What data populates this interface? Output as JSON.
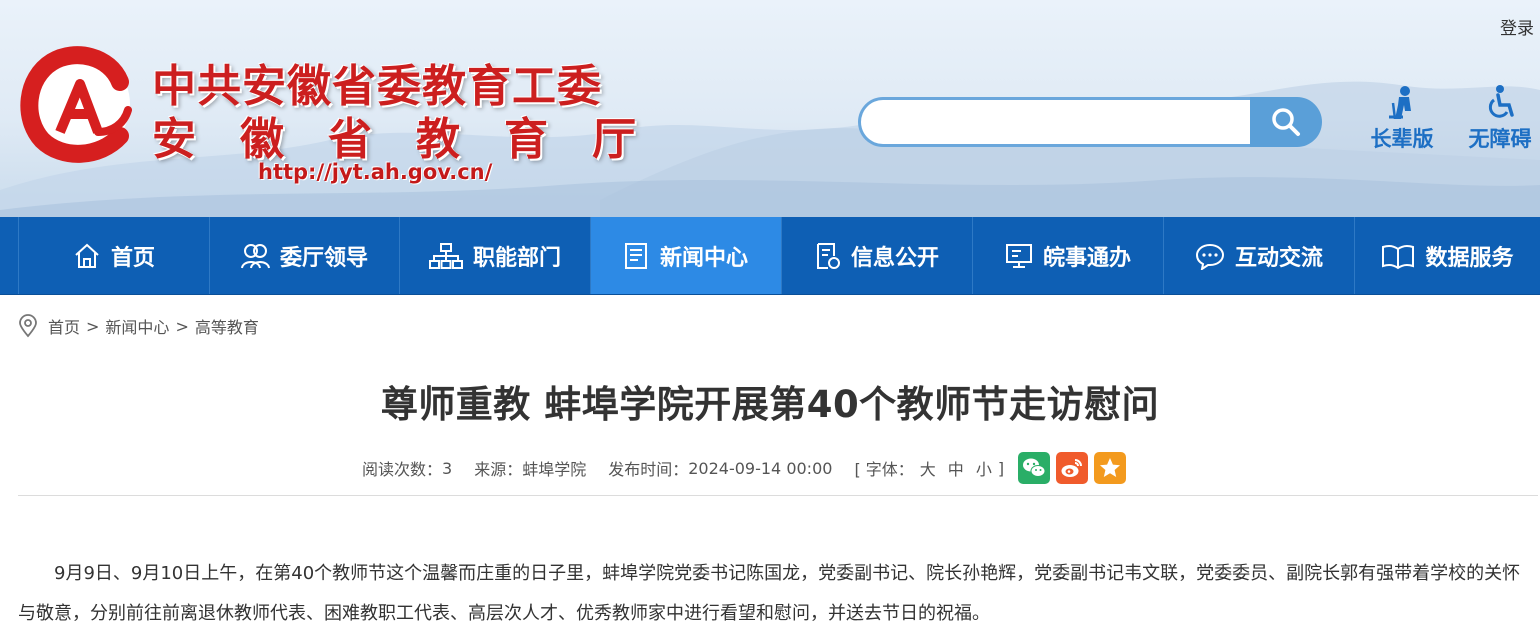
{
  "header": {
    "login_label": "登录",
    "org_name_line1": "中共安徽省委教育工委",
    "org_name_line2": "安徽省教育厅",
    "site_url": "http://jyt.ah.gov.cn/",
    "search_placeholder": "",
    "search_icon": "search-icon",
    "utilities": [
      {
        "label": "长辈版",
        "icon": "elder-person-icon"
      },
      {
        "label": "无障碍",
        "icon": "wheelchair-icon"
      }
    ],
    "brand_color": "#cc1f1f",
    "accent_color": "#1d6fc4"
  },
  "nav": {
    "active_index": 3,
    "bar_color": "#0e5fb4",
    "active_color": "#2d8ae5",
    "items": [
      {
        "label": "首页",
        "icon": "home-icon"
      },
      {
        "label": "委厅领导",
        "icon": "people-icon"
      },
      {
        "label": "职能部门",
        "icon": "org-chart-icon"
      },
      {
        "label": "新闻中心",
        "icon": "news-document-icon"
      },
      {
        "label": "信息公开",
        "icon": "info-document-icon"
      },
      {
        "label": "皖事通办",
        "icon": "monitor-icon"
      },
      {
        "label": "互动交流",
        "icon": "chat-bubble-icon"
      },
      {
        "label": "数据服务",
        "icon": "open-book-icon"
      }
    ]
  },
  "breadcrumb": {
    "icon": "location-pin-icon",
    "items": [
      "首页",
      "新闻中心",
      "高等教育"
    ],
    "separator": ">"
  },
  "article": {
    "title": "尊师重教 蚌埠学院开展第40个教师节走访慰问",
    "meta": {
      "views_label": "阅读次数：",
      "views": "3",
      "source_label": "来源：",
      "source": "蚌埠学院",
      "published_label": "发布时间：",
      "published": "2024-09-14 00:00",
      "font_open": "[ 字体：",
      "font_large": "大",
      "font_medium": "中",
      "font_small": "小",
      "font_close": "]"
    },
    "share": [
      {
        "icon": "wechat-icon",
        "color": "#2aae67"
      },
      {
        "icon": "weibo-icon",
        "color": "#f05b2c"
      },
      {
        "icon": "favorite-star-icon",
        "color": "#f39a1e"
      }
    ],
    "paragraph": "9月9日、9月10日上午，在第40个教师节这个温馨而庄重的日子里，蚌埠学院党委书记陈国龙，党委副书记、院长孙艳辉，党委副书记韦文联，党委委员、副院长郭有强带着学校的关怀与敬意，分别前往前离退休教师代表、困难教职工代表、高层次人才、优秀教师家中进行看望和慰问，并送去节日的祝福。"
  }
}
